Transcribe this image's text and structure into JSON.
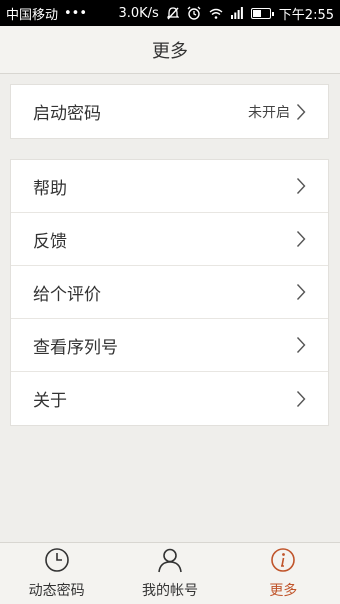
{
  "status_bar": {
    "carrier": "中国移动",
    "dots": "•••",
    "speed": "3.0K/s",
    "time": "下午2:55"
  },
  "header": {
    "title": "更多"
  },
  "groups": [
    {
      "items": [
        {
          "label": "启动密码",
          "value": "未开启"
        }
      ]
    },
    {
      "items": [
        {
          "label": "帮助"
        },
        {
          "label": "反馈"
        },
        {
          "label": "给个评价"
        },
        {
          "label": "查看序列号"
        },
        {
          "label": "关于"
        }
      ]
    }
  ],
  "tabs": [
    {
      "label": "动态密码",
      "icon": "clock-icon",
      "active": false
    },
    {
      "label": "我的帐号",
      "icon": "person-icon",
      "active": false
    },
    {
      "label": "更多",
      "icon": "info-icon",
      "active": true
    }
  ],
  "colors": {
    "active_tab": "#c0542a",
    "background": "#efeeeb"
  }
}
